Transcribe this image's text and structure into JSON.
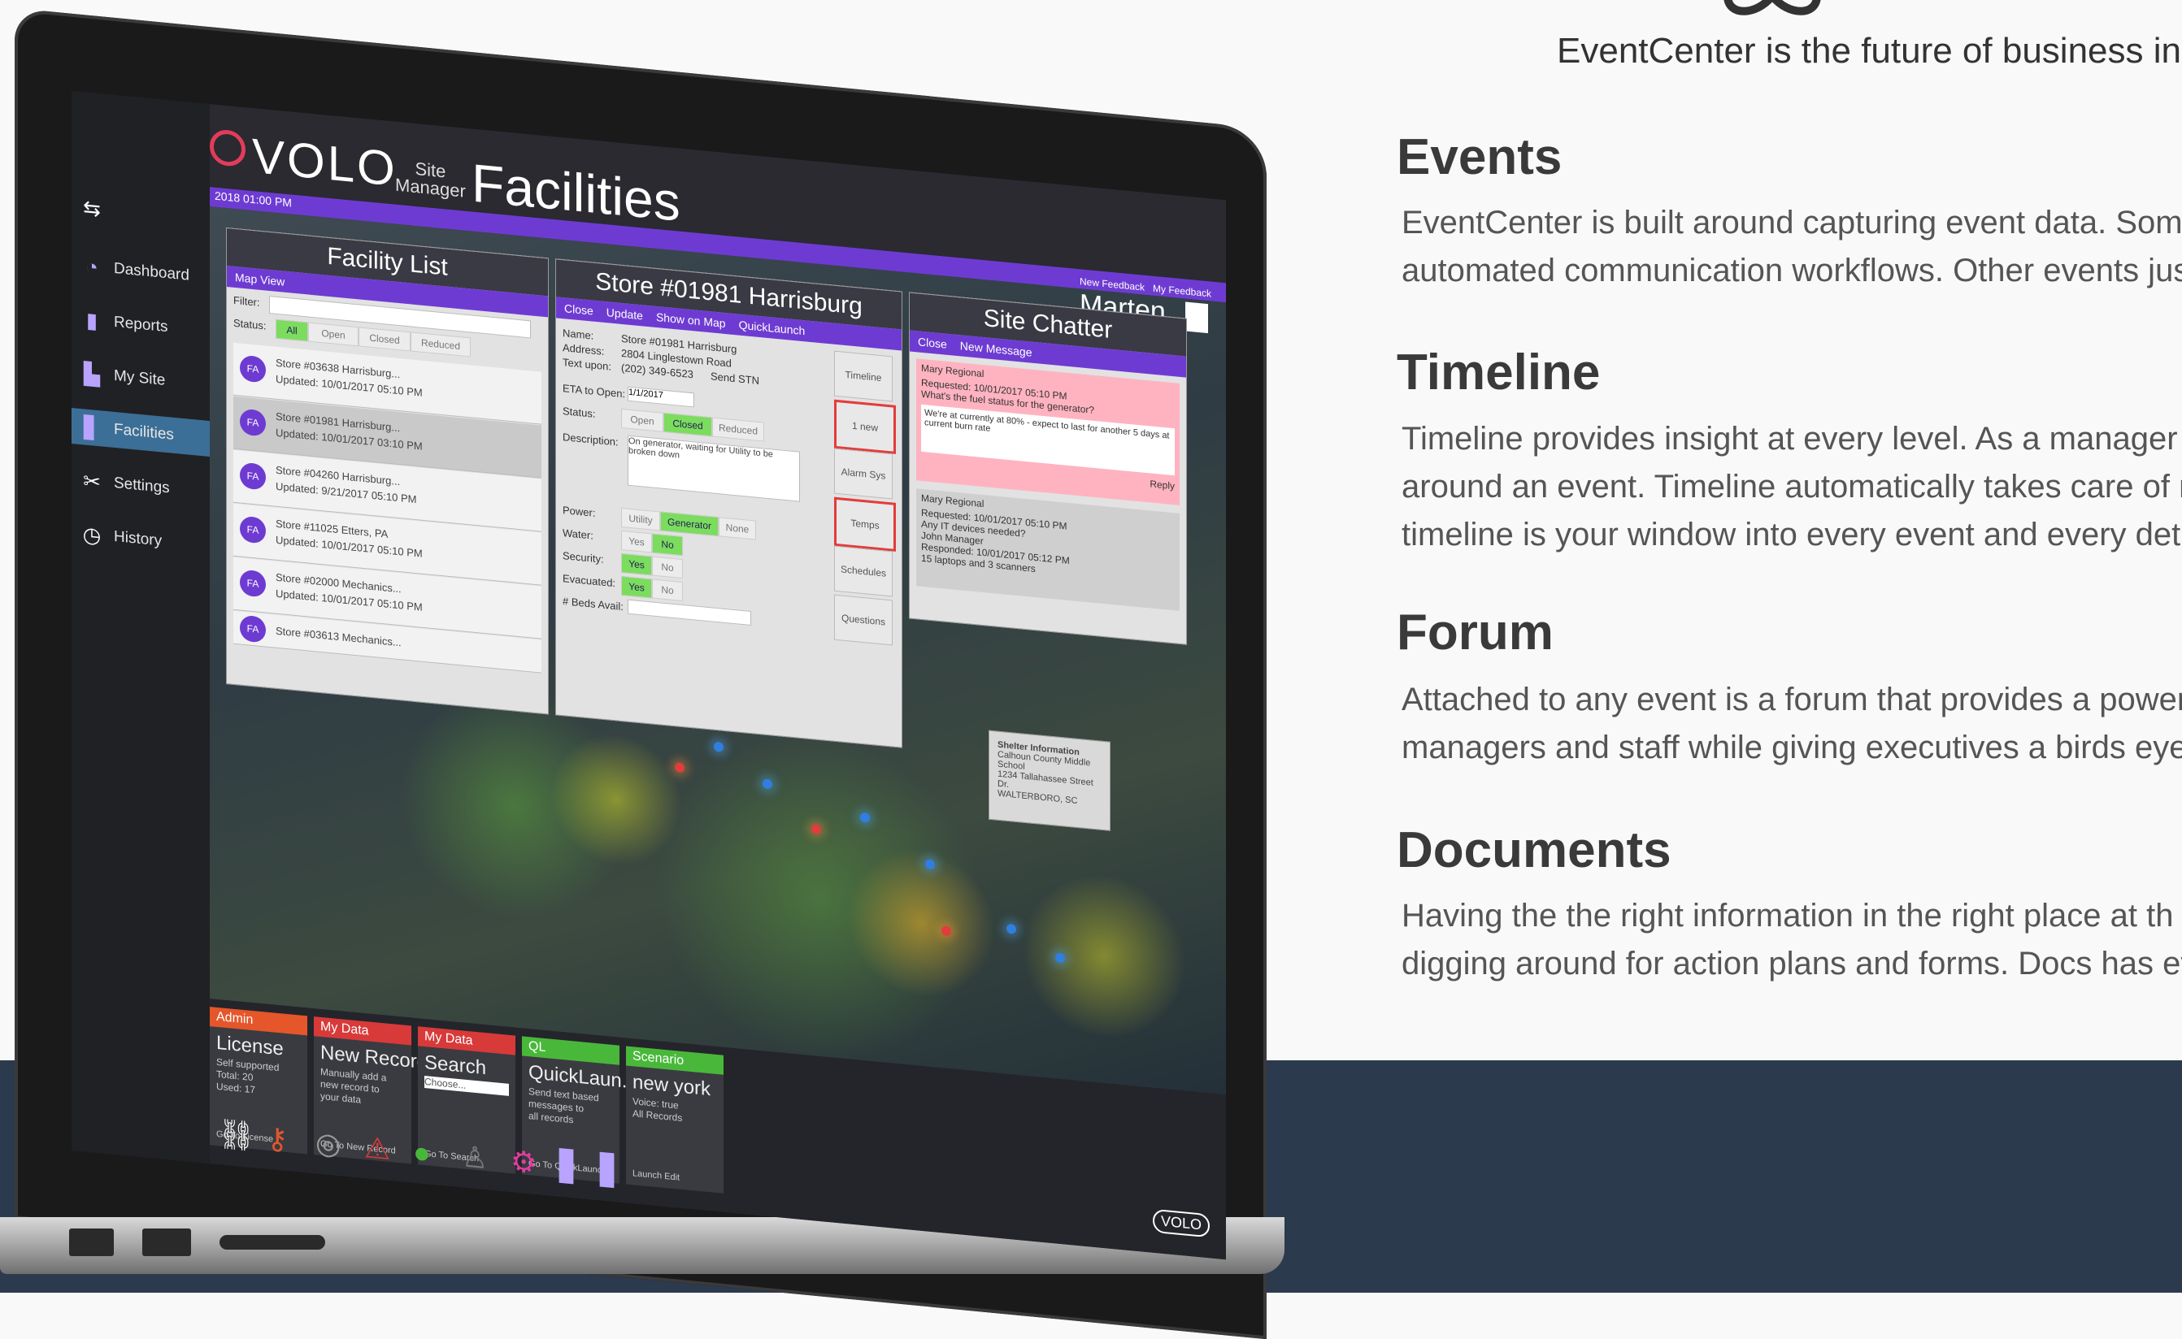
{
  "page": {
    "tagline": "EventCenter is the future of business in",
    "sections": [
      {
        "title": "Events",
        "lines": [
          "EventCenter is built around capturing event data. Some",
          "automated communication workflows. Other events jus"
        ]
      },
      {
        "title": "Timeline",
        "lines": [
          "Timeline provides insight at every level. As a manager y",
          "around an event. Timeline automatically takes care of r",
          "timeline is your window into every event and every deta"
        ]
      },
      {
        "title": "Forum",
        "lines": [
          "Attached to any event is a forum that provides a power",
          "managers and staff while giving executives a birds eye"
        ]
      },
      {
        "title": "Documents",
        "lines": [
          "Having the the right information in the right place at th",
          "digging around for action plans and forms. Docs has ev"
        ]
      }
    ],
    "colors": {
      "band": "#2b3a4d",
      "accent": "#6e3bd2",
      "active_nav": "#3c6f97"
    }
  },
  "app": {
    "brand": "VOLO",
    "site_manager": [
      "Site",
      "Manager"
    ],
    "title": "Facilities",
    "datetime": "2018 01:00 PM",
    "user": "Marten",
    "sidebar": [
      {
        "label": "Dashboard",
        "icon": "gauge-icon"
      },
      {
        "label": "Reports",
        "icon": "bar-chart-icon"
      },
      {
        "label": "My Site",
        "icon": "site-icon"
      },
      {
        "label": "Facilities",
        "icon": "building-icon",
        "active": true
      },
      {
        "label": "Settings",
        "icon": "wrench-icon"
      },
      {
        "label": "History",
        "icon": "history-icon"
      }
    ],
    "facility_list": {
      "title": "Facility List",
      "map_view": "Map View",
      "filter_label": "Filter:",
      "status_label": "Status:",
      "status_options": [
        "All",
        "Open",
        "Closed",
        "Reduced"
      ],
      "rows": [
        {
          "initials": "FA",
          "name": "Store #03638 Harrisburg...",
          "updated": "Updated: 10/01/2017 05:10 PM"
        },
        {
          "initials": "FA",
          "name": "Store #01981 Harrisburg...",
          "updated": "Updated: 10/01/2017 03:10 PM",
          "selected": true
        },
        {
          "initials": "FA",
          "name": "Store #04260 Harrisburg...",
          "updated": "Updated: 9/21/2017 05:10 PM"
        },
        {
          "initials": "FA",
          "name": "Store #11025 Etters, PA",
          "updated": "Updated: 10/01/2017 05:10 PM"
        },
        {
          "initials": "FA",
          "name": "Store #02000 Mechanics...",
          "updated": "Updated: 10/01/2017 05:10 PM"
        },
        {
          "initials": "FA",
          "name": "Store #03613 Mechanics...",
          "updated": ""
        }
      ]
    },
    "store": {
      "title": "Store #01981 Harrisburg",
      "actions": [
        "Close",
        "Update",
        "Show on Map",
        "QuickLaunch"
      ],
      "name_label": "Name:",
      "name": "Store #01981 Harrisburg",
      "address_label": "Address:",
      "address": "2804 Linglestown Road",
      "phone_label": "Text upon:",
      "phone": "(202) 349-6523",
      "send_stn": "Send STN",
      "eta_label": "ETA to Open:",
      "eta": "1/1/2017",
      "status_label": "Status:",
      "status_options": [
        "Open",
        "Closed",
        "Reduced"
      ],
      "desc_label": "Description:",
      "desc": "On generator, waiting for Utility to be broken down",
      "power_label": "Power:",
      "power_options": [
        "Utility",
        "Generator",
        "None"
      ],
      "water_label": "Water:",
      "security_label": "Security:",
      "evacuated_label": "Evacuated:",
      "yes": "Yes",
      "no": "No",
      "beds_label": "# Beds Avail:",
      "side_buttons": [
        "Timeline",
        "1 new",
        "Alarm Sys",
        "Temps",
        "Schedules",
        "Questions"
      ]
    },
    "chatter": {
      "title": "Site Chatter",
      "top_actions": [
        "New Feedback",
        "My Feedback"
      ],
      "actions": [
        "Close",
        "New Message"
      ],
      "messages": [
        {
          "author": "Mary Regional",
          "requested": "Requested: 10/01/2017 05:10 PM",
          "text": "What's the fuel status for the generator?",
          "reply": "We're at currently at 80% - expect to last for another 5 days at current burn rate",
          "reply_label": "Reply"
        },
        {
          "author": "Mary Regional",
          "requested": "Requested: 10/01/2017 05:10 PM",
          "text": "Any IT devices needed?",
          "responder": "John Manager",
          "responded": "Responded: 10/01/2017 05:12 PM",
          "reply": "15 laptops and 3 scanners"
        }
      ]
    },
    "shelter": {
      "title": "Shelter Information",
      "lines": [
        "Calhoun County Middle School",
        "1234 Tallahassee Street Dr.",
        "WALTERBORO, SC"
      ]
    },
    "dock": [
      {
        "tag": "Admin",
        "title": "License",
        "desc": [
          "Self supported",
          "Total: 20",
          "Used: 17"
        ],
        "foot": "Go To License",
        "color": "#e5562b"
      },
      {
        "tag": "My Data",
        "title": "New Record",
        "desc": [
          "Manually add a",
          "new record to",
          "your data"
        ],
        "foot": "Go To New Record",
        "color": "#d83a3a"
      },
      {
        "tag": "My Data",
        "title": "Search",
        "desc": [
          "Choose..."
        ],
        "foot": "Go To Search",
        "color": "#d83a3a"
      },
      {
        "tag": "QL",
        "title": "QuickLaun...",
        "desc": [
          "Send text based",
          "messages to",
          "all records"
        ],
        "foot": "Go To QuickLaunch",
        "color": "#49b83a"
      },
      {
        "tag": "Scenario",
        "title": "new york",
        "desc": [
          "Voice: true",
          "All Records"
        ],
        "foot": "Launch   Edit",
        "color": "#49b83a"
      }
    ],
    "bottom_icons": [
      "link-icon",
      "key-icon",
      "globe-icon",
      "warning-icon",
      "chat-icon",
      "user-icon",
      "gear-icon",
      "building-icon",
      "building-icon"
    ],
    "brand_badge": "VOLO"
  }
}
